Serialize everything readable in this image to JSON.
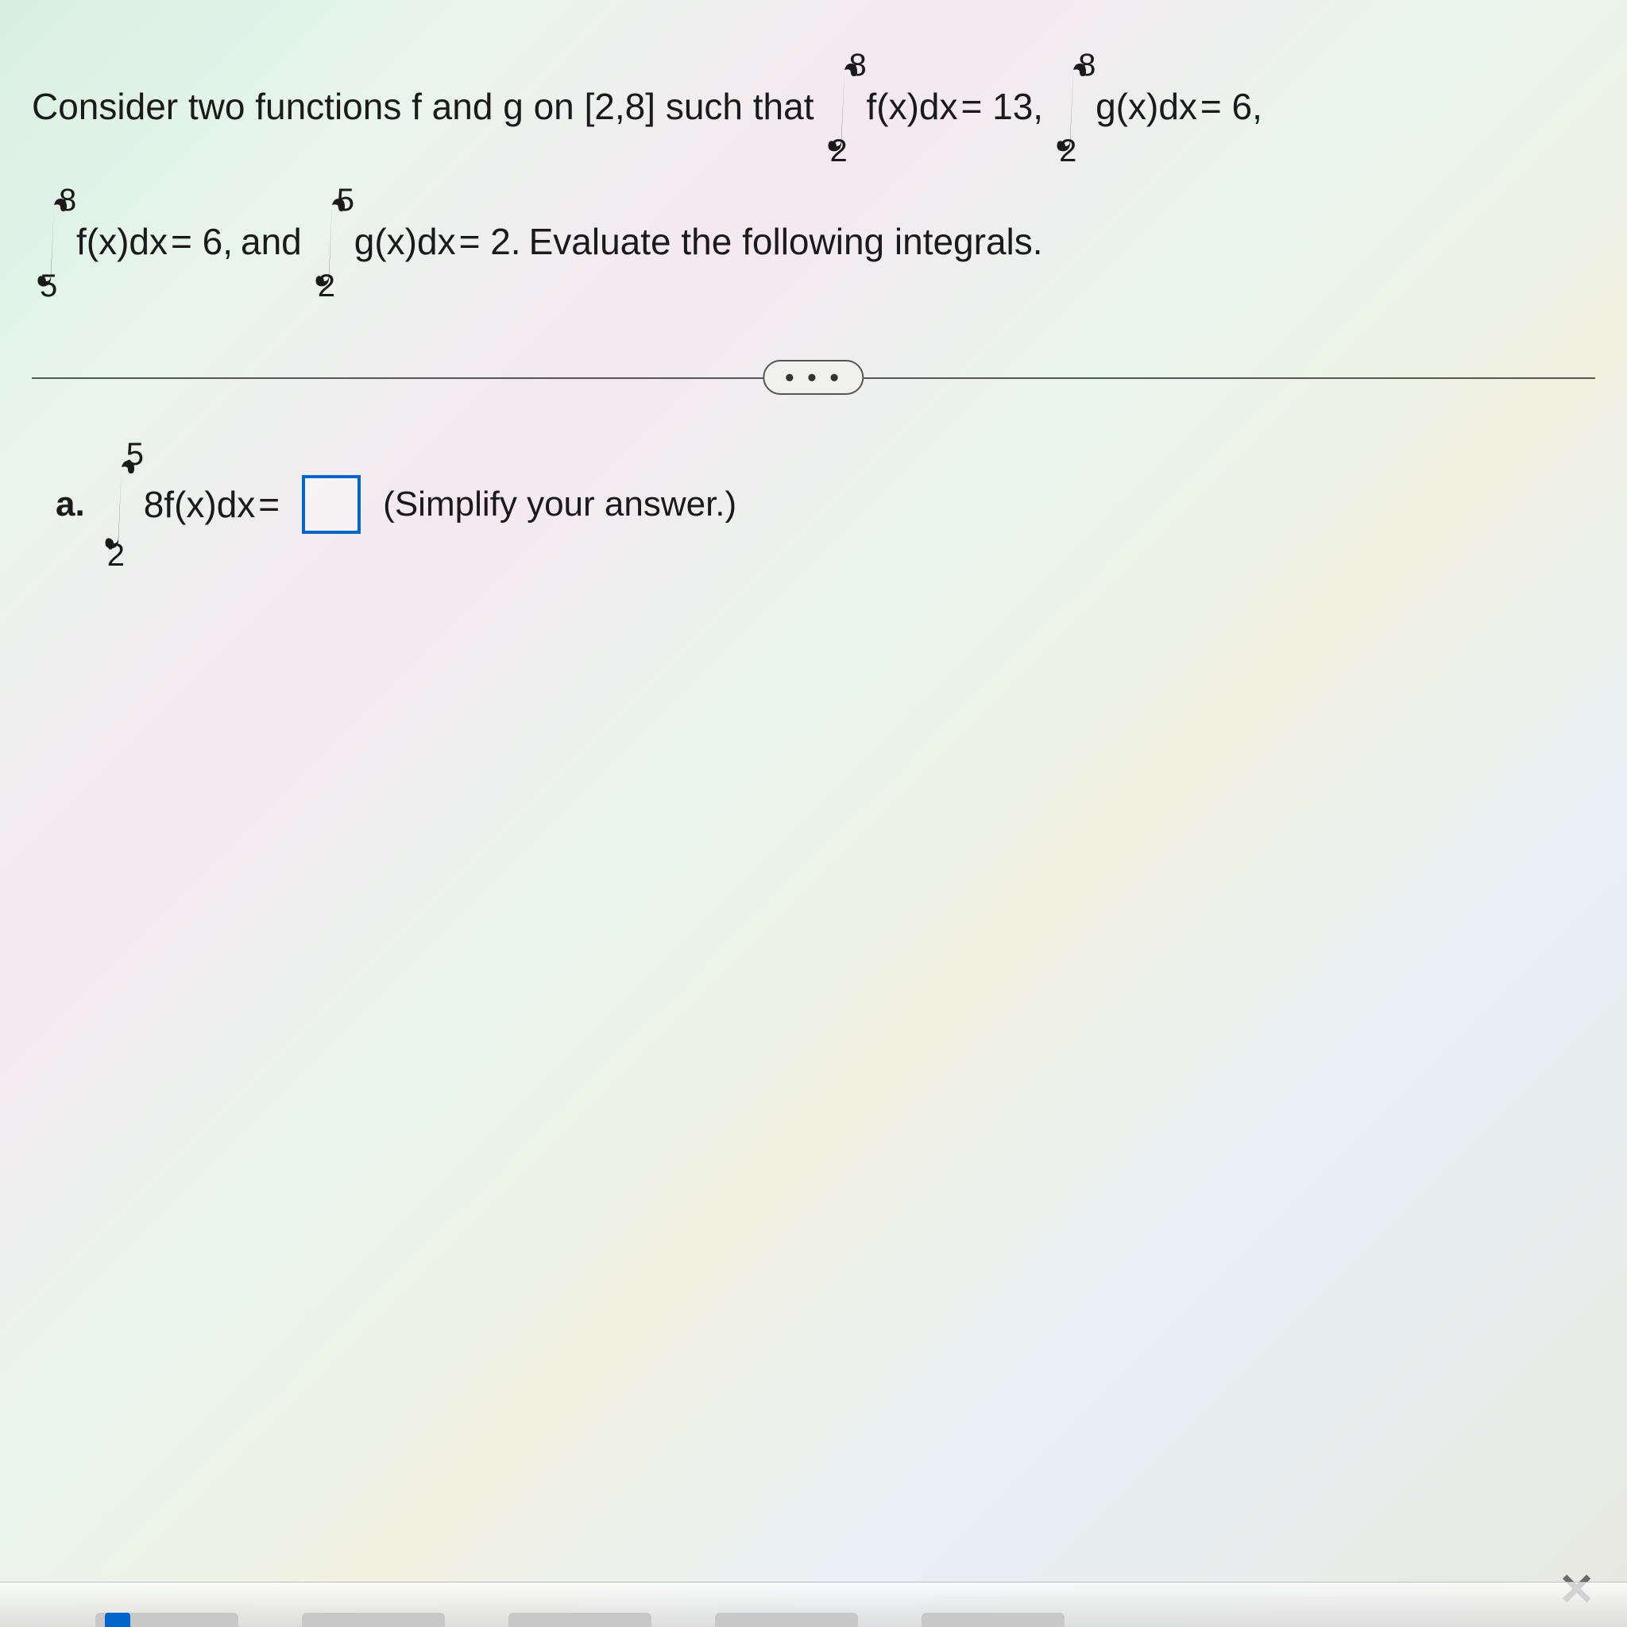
{
  "problem": {
    "intro_a": "Consider two functions f and g on [2,8] such that",
    "int1": {
      "top": "8",
      "bot": "2",
      "body": "f(x)dx",
      "eq": "= 13,"
    },
    "int2": {
      "top": "8",
      "bot": "2",
      "body": "g(x)dx",
      "eq": "= 6,"
    },
    "int3": {
      "top": "8",
      "bot": "5",
      "body": "f(x)dx",
      "eq": "= 6,"
    },
    "joiner": "and",
    "int4": {
      "top": "5",
      "bot": "2",
      "body": "g(x)dx",
      "eq": "= 2."
    },
    "tail": "Evaluate the following integrals."
  },
  "divider": {
    "dots": "• • •"
  },
  "part_a": {
    "label": "a.",
    "int": {
      "top": "5",
      "bot": "2",
      "body": "8f(x)dx",
      "eq": "="
    },
    "hint": "(Simplify your answer.)"
  },
  "corner": {
    "x": "✕"
  }
}
